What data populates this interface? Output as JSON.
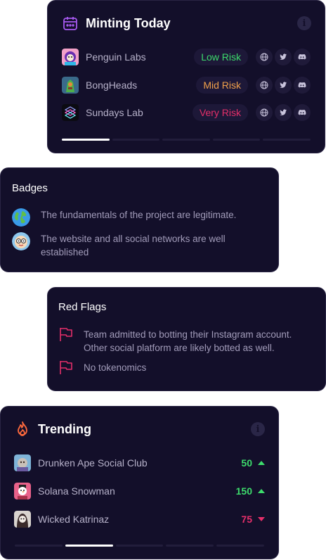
{
  "colors": {
    "background": "#130f2a",
    "low_risk": "#3ddc6c",
    "mid_risk": "#f0a04b",
    "very_risk": "#e52f6a",
    "trend_up": "#3ddc6c",
    "trend_down": "#e52f6a",
    "calendar_icon": "#a75af0",
    "fire_icon": "#ff6a3d",
    "flag_icon": "#e52f6a"
  },
  "minting": {
    "title": "Minting Today",
    "info_icon": "info-icon",
    "projects": [
      {
        "name": "Penguin Labs",
        "risk": "Low Risk",
        "risk_level": "low",
        "avatar": "penguin-avatar"
      },
      {
        "name": "BongHeads",
        "risk": "Mid Risk",
        "risk_level": "mid",
        "avatar": "bonghead-avatar"
      },
      {
        "name": "Sundays Lab",
        "risk": "Very Risk",
        "risk_level": "very",
        "avatar": "sundays-lab-avatar"
      }
    ],
    "social_icons": [
      "globe-icon",
      "twitter-icon",
      "discord-icon"
    ],
    "pager": {
      "pages": 5,
      "active": 0
    }
  },
  "badges": {
    "title": "Badges",
    "items": [
      {
        "icon": "earth-icon",
        "text": "The fundamentals of the project are legitimate."
      },
      {
        "icon": "nerd-face-icon",
        "text": "The website and all social networks are well established"
      }
    ]
  },
  "red_flags": {
    "title": "Red Flags",
    "items": [
      {
        "icon": "flag-icon",
        "text": "Team admitted to botting their Instagram account. Other social platform are likely botted as well."
      },
      {
        "icon": "flag-icon",
        "text": "No tokenomics"
      }
    ]
  },
  "trending": {
    "title": "Trending",
    "info_icon": "info-icon",
    "items": [
      {
        "name": "Drunken Ape Social Club",
        "value": "50",
        "direction": "up",
        "avatar": "drunken-ape-avatar"
      },
      {
        "name": "Solana Snowman",
        "value": "150",
        "direction": "up",
        "avatar": "solana-snowman-avatar"
      },
      {
        "name": "Wicked Katrinaz",
        "value": "75",
        "direction": "down",
        "avatar": "wicked-katrinaz-avatar"
      }
    ],
    "pager": {
      "pages": 5,
      "active": 1
    }
  }
}
